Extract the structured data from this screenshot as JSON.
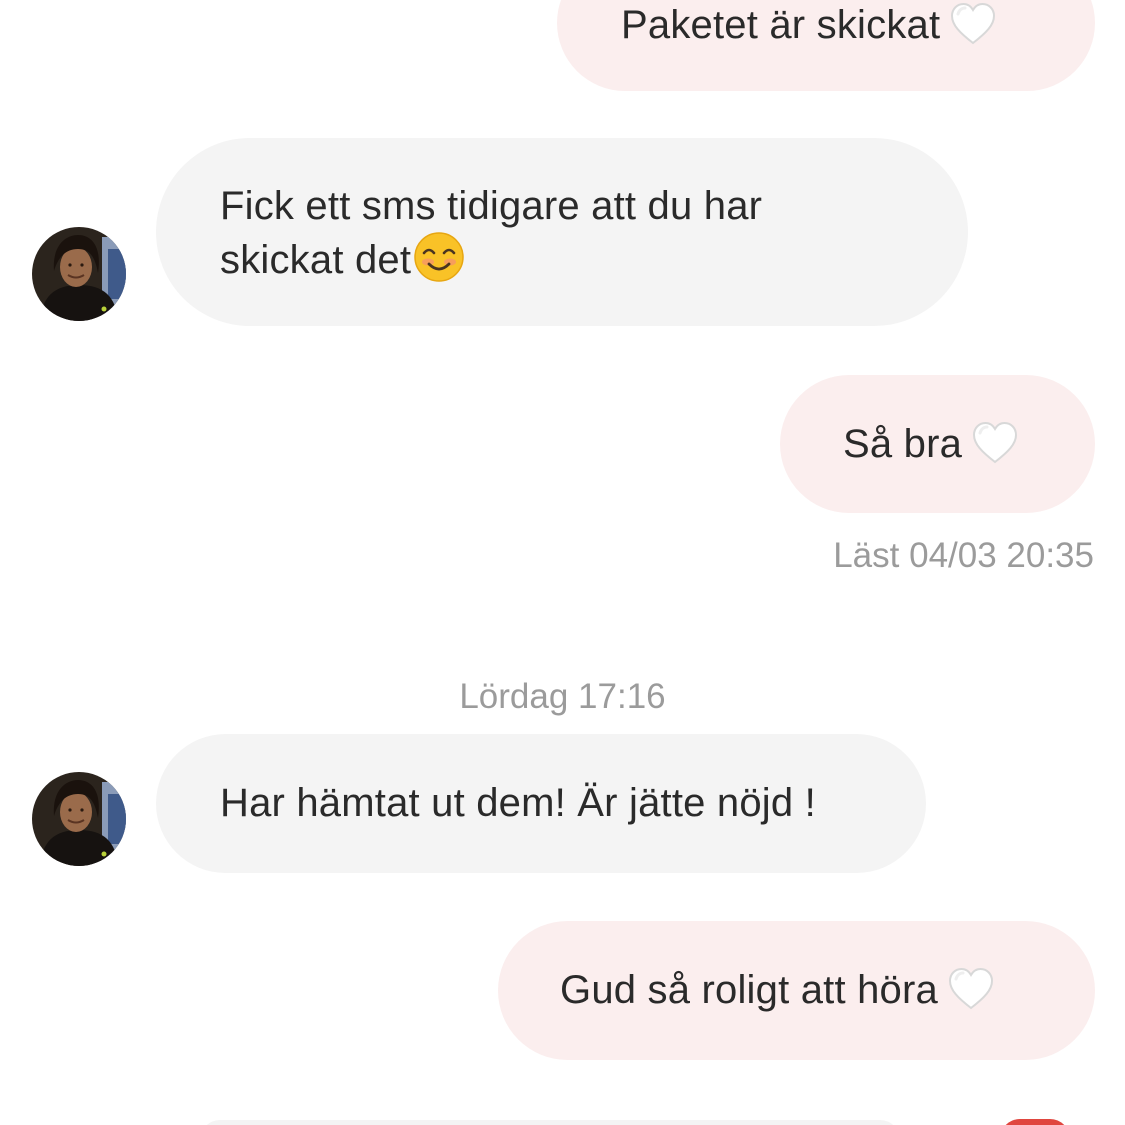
{
  "messages": [
    {
      "direction": "outgoing",
      "text": "Paketet är skickat",
      "emoji": "white-heart"
    },
    {
      "direction": "incoming",
      "line1": "Fick ett sms tidigare att du har",
      "line2": "skickat det",
      "emoji": "smiling-face"
    },
    {
      "direction": "outgoing",
      "text": "Så bra",
      "emoji": "white-heart"
    },
    {
      "direction": "incoming",
      "text": "Har hämtat ut dem! Är jätte nöjd !"
    },
    {
      "direction": "outgoing",
      "text": "Gud så roligt att höra",
      "emoji": "white-heart"
    }
  ],
  "read_receipt": "Läst 04/03 20:35",
  "day_separator": "Lördag 17:16",
  "colors": {
    "outgoing_bubble": "#fbeeee",
    "incoming_bubble": "#f4f4f4",
    "meta_text": "#9b9b9b",
    "message_text": "#2a2a2a"
  }
}
